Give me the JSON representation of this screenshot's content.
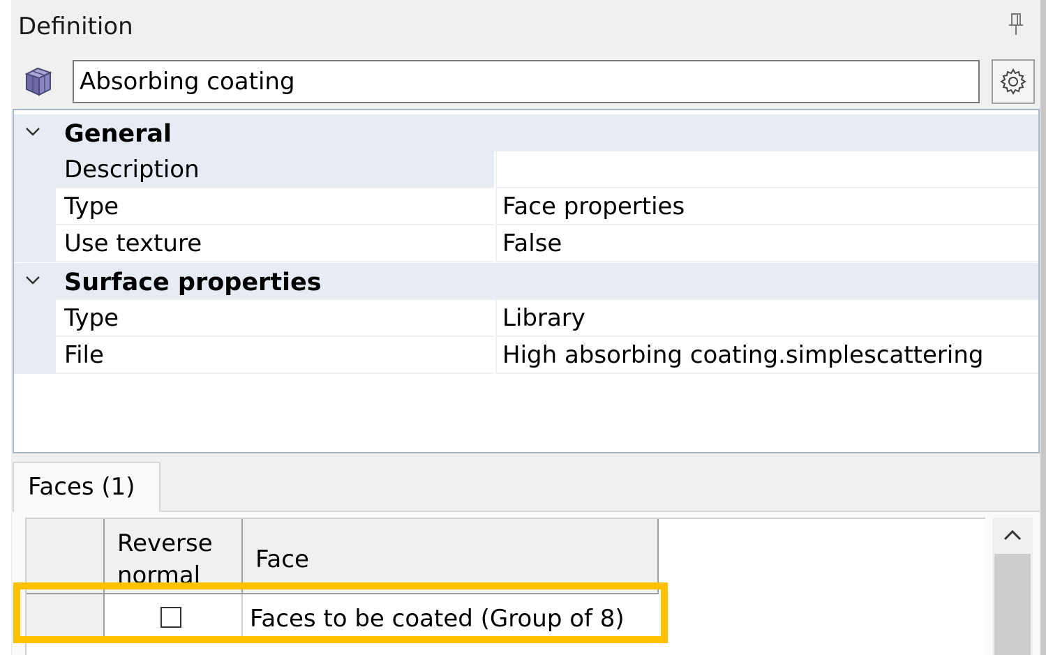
{
  "panel": {
    "title": "Definition"
  },
  "object": {
    "name": "Absorbing coating"
  },
  "properties": {
    "general": {
      "label": "General",
      "rows": [
        {
          "name": "Description",
          "value": ""
        },
        {
          "name": "Type",
          "value": "Face properties"
        },
        {
          "name": "Use texture",
          "value": "False"
        }
      ]
    },
    "surface": {
      "label": "Surface properties",
      "rows": [
        {
          "name": "Type",
          "value": "Library"
        },
        {
          "name": "File",
          "value": "High absorbing coating.simplescattering"
        }
      ]
    }
  },
  "tabs": [
    {
      "label": "Faces (1)",
      "active": true
    }
  ],
  "faces_grid": {
    "columns": [
      "Reverse normal",
      "Face"
    ],
    "rows": [
      {
        "reverse_normal": false,
        "face": "Faces to be coated (Group of 8)"
      }
    ]
  },
  "icons": {
    "pin": "pin-icon",
    "object": "cube-icon",
    "settings": "gear-icon",
    "collapse": "chevron-down-icon",
    "scroll": "chevron-up-icon"
  },
  "colors": {
    "highlight": "#ffc000",
    "category_bg": "#e7ecf4"
  }
}
